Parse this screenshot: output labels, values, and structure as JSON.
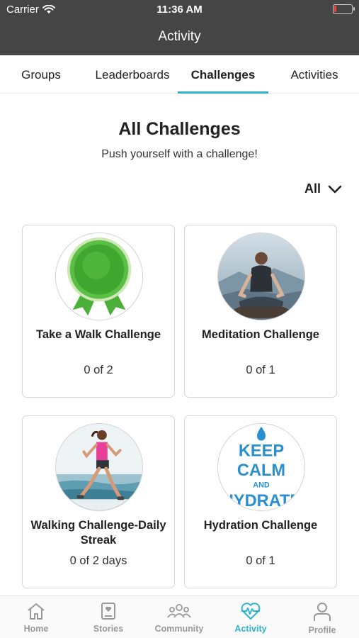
{
  "status_bar": {
    "carrier": "Carrier",
    "time": "11:36 AM"
  },
  "header": {
    "title": "Activity"
  },
  "tabs": [
    {
      "label": "Groups",
      "active": false
    },
    {
      "label": "Leaderboards",
      "active": false
    },
    {
      "label": "Challenges",
      "active": true
    },
    {
      "label": "Activities",
      "active": false
    }
  ],
  "page": {
    "title": "All Challenges",
    "subtitle": "Push yourself with a challenge!",
    "filter_label": "All"
  },
  "challenges": [
    {
      "title": "Take a Walk Challenge",
      "progress": "0 of 2",
      "image": "green-ribbon-badge"
    },
    {
      "title": "Meditation Challenge",
      "progress": "0 of 1",
      "image": "meditation-photo"
    },
    {
      "title": "Walking Challenge-Daily Streak",
      "progress": "0 of 2 days",
      "image": "walking-woman-illustration"
    },
    {
      "title": "Hydration Challenge",
      "progress": "0 of 1",
      "image": "keep-calm-hydrate",
      "image_text": {
        "line1": "KEEP",
        "line2": "CALM",
        "line3": "AND",
        "line4": "HYDRATE"
      }
    }
  ],
  "bottom_nav": [
    {
      "label": "Home",
      "icon": "home-icon",
      "active": false
    },
    {
      "label": "Stories",
      "icon": "book-icon",
      "active": false
    },
    {
      "label": "Community",
      "icon": "people-icon",
      "active": false
    },
    {
      "label": "Activity",
      "icon": "heart-pulse-icon",
      "active": true
    },
    {
      "label": "Profile",
      "icon": "person-icon",
      "active": false
    }
  ],
  "colors": {
    "accent": "#2cb4cf",
    "header_bg": "#454545",
    "inactive_nav": "#999999"
  }
}
